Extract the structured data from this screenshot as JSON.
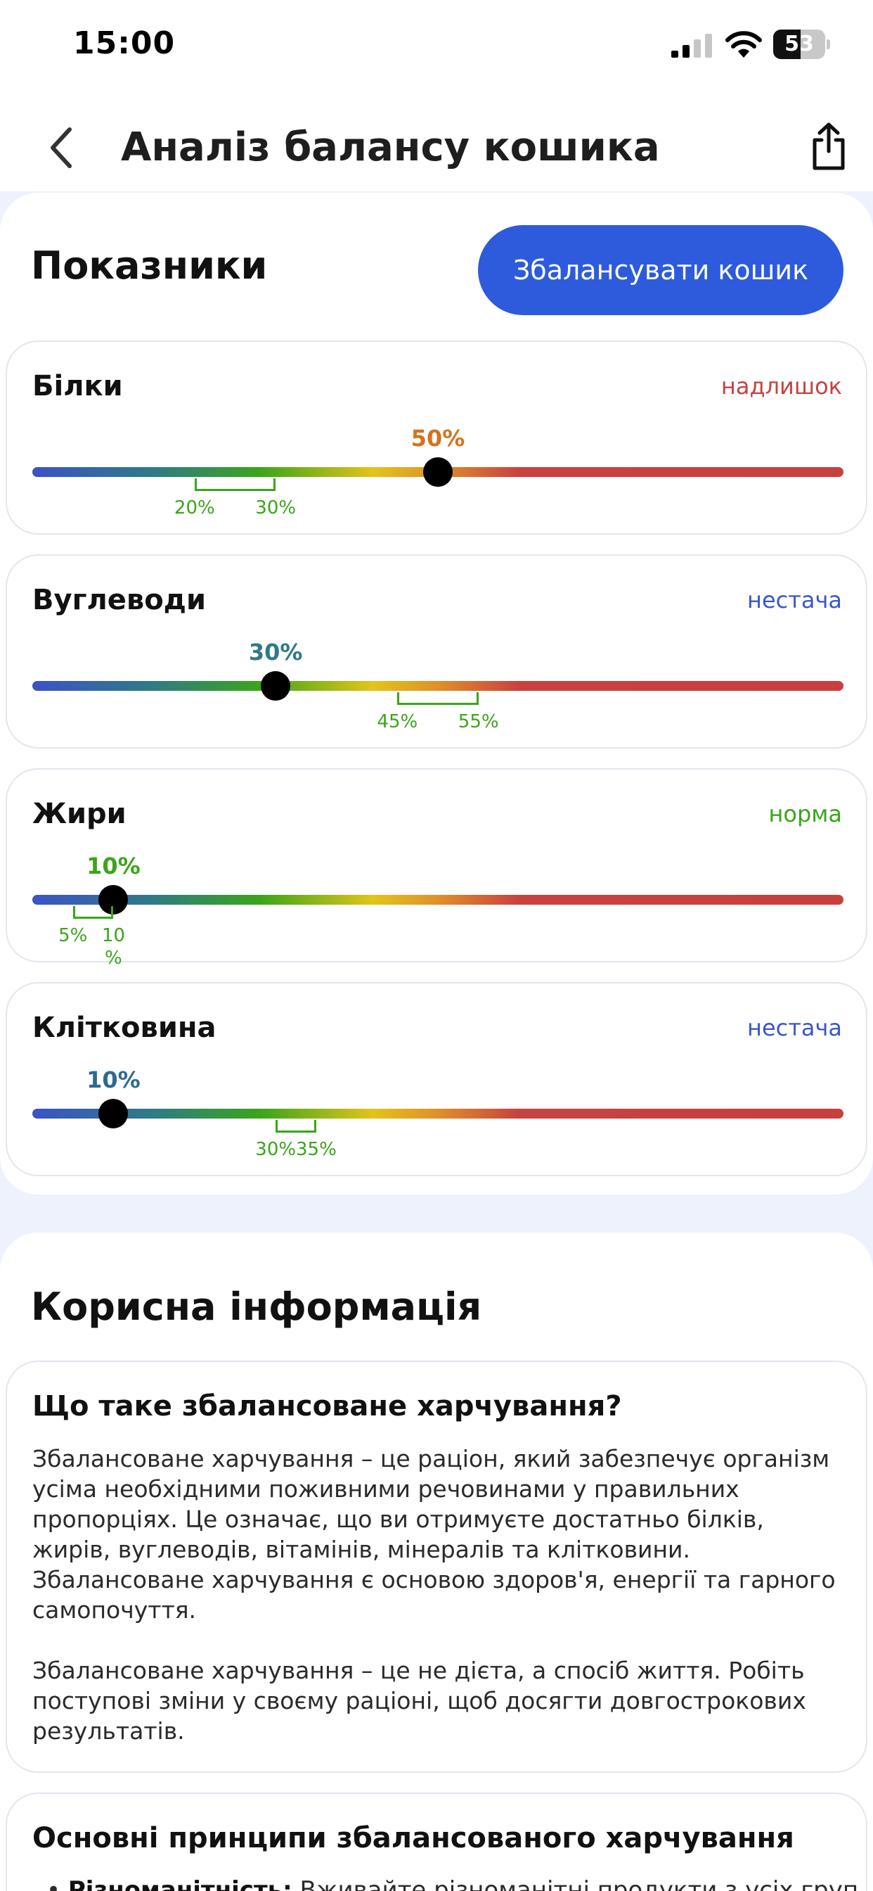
{
  "status_bar": {
    "time": "15:00",
    "battery": "53",
    "battery_level": 0.53
  },
  "header": {
    "title": "Аналіз балансу кошика",
    "back_icon": "chevron-left-icon",
    "share_icon": "share-icon"
  },
  "indicators": {
    "title": "Показники",
    "balance_button": "Збалансувати кошик",
    "items": [
      {
        "name": "Білки",
        "status": "надлишок",
        "status_color": "#c8423f",
        "value_label": "50%",
        "value": 50,
        "value_color": "#d4731c",
        "range_min_label": "20%",
        "range_max_label": "30%",
        "range_min": 20,
        "range_max": 30
      },
      {
        "name": "Вуглеводи",
        "status": "нестача",
        "status_color": "#3a57c8",
        "value_label": "30%",
        "value": 30,
        "value_color": "#2f7a86",
        "range_min_label": "45%",
        "range_max_label": "55%",
        "range_min": 45,
        "range_max": 55
      },
      {
        "name": "Жири",
        "status": "норма",
        "status_color": "#3aa51a",
        "value_label": "10%",
        "value": 10,
        "value_color": "#3aa51a",
        "range_min_label": "5%",
        "range_max_label": "10\n%",
        "range_min": 5,
        "range_max": 10
      },
      {
        "name": "Клітковина",
        "status": "нестача",
        "status_color": "#3a57c8",
        "value_label": "10%",
        "value": 10,
        "value_color": "#2d6a92",
        "range_min_label": "30%",
        "range_max_label": "35%",
        "range_min": 30,
        "range_max": 35
      }
    ]
  },
  "info": {
    "title": "Корисна інформація",
    "card1": {
      "title": "Що таке збалансоване харчування?",
      "paragraph1": "Збалансоване харчування – це раціон, який забезпечує організм усіма необхідними поживними речовинами у правильних пропорціях. Це означає, що ви отримуєте достатньо білків, жирів, вуглеводів, вітамінів, мінералів та клітковини. Збалансоване харчування є основою здоров'я, енергії та гарного самопочуття.",
      "paragraph2": "Збалансоване харчування – це не дієта, а спосіб життя. Робіть поступові зміни у своєму раціоні, щоб досягти довгострокових результатів."
    },
    "card2": {
      "title": "Основні принципи збалансованого харчування",
      "bullet1_bold": "Різноманітність:",
      "bullet1_text": " Вживайте різноманітні продукти з усіх груп"
    }
  }
}
